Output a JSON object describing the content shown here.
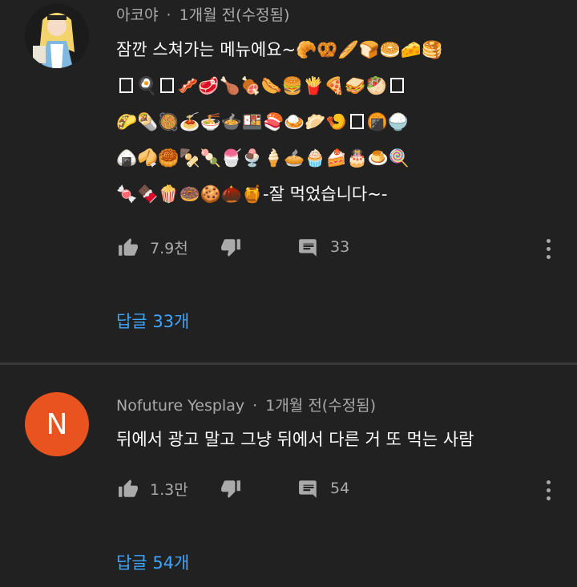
{
  "comments": [
    {
      "author": "아코야",
      "time": "1개월 전(수정됨)",
      "separator": "·",
      "text_parts": {
        "line1_text": "잠깐 스쳐가는 메뉴에요~",
        "line1_emoji": "🥐🥨🥖🍞🥯🧀🥞",
        "line2_emoji_a": "🍳",
        "line2_emoji_b": "🥓🥩🍗🍖🌭🍔🍟🍕🥪🥙",
        "line3_emoji_a": "🌮🌯🥘🍝🍜🍲🍱🍣🍛🥟🍤",
        "line3_emoji_b": "🍘🍚",
        "line4_emoji": "🍙🥠🥮🍢🍡🍧🍨🍦🥧🧁🍰🎂🍮🍭",
        "line5_emoji": "🍬🍫🍿🍩🍪🌰🍯",
        "line5_text": "-잘 먹었습니다~-"
      },
      "likes": "7.9천",
      "reply_count": "33",
      "replies_link": "답글 33개"
    },
    {
      "author": "Nofuture Yesplay",
      "time": "1개월 전(수정됨)",
      "separator": "·",
      "avatar_letter": "N",
      "text": "뒤에서 광고 말고 그냥 뒤에서 다른 거 또 먹는 사람",
      "likes": "1.3만",
      "reply_count": "54",
      "replies_link": "답글 54개"
    }
  ],
  "icons": {
    "like": "thumb-up-icon",
    "dislike": "thumb-down-icon",
    "reply": "comment-icon",
    "more": "more-vert-icon"
  },
  "colors": {
    "background": "#212121",
    "link": "#3ea6ff",
    "secondary_text": "#aaaaaa",
    "avatar2_bg": "#e8531f"
  }
}
